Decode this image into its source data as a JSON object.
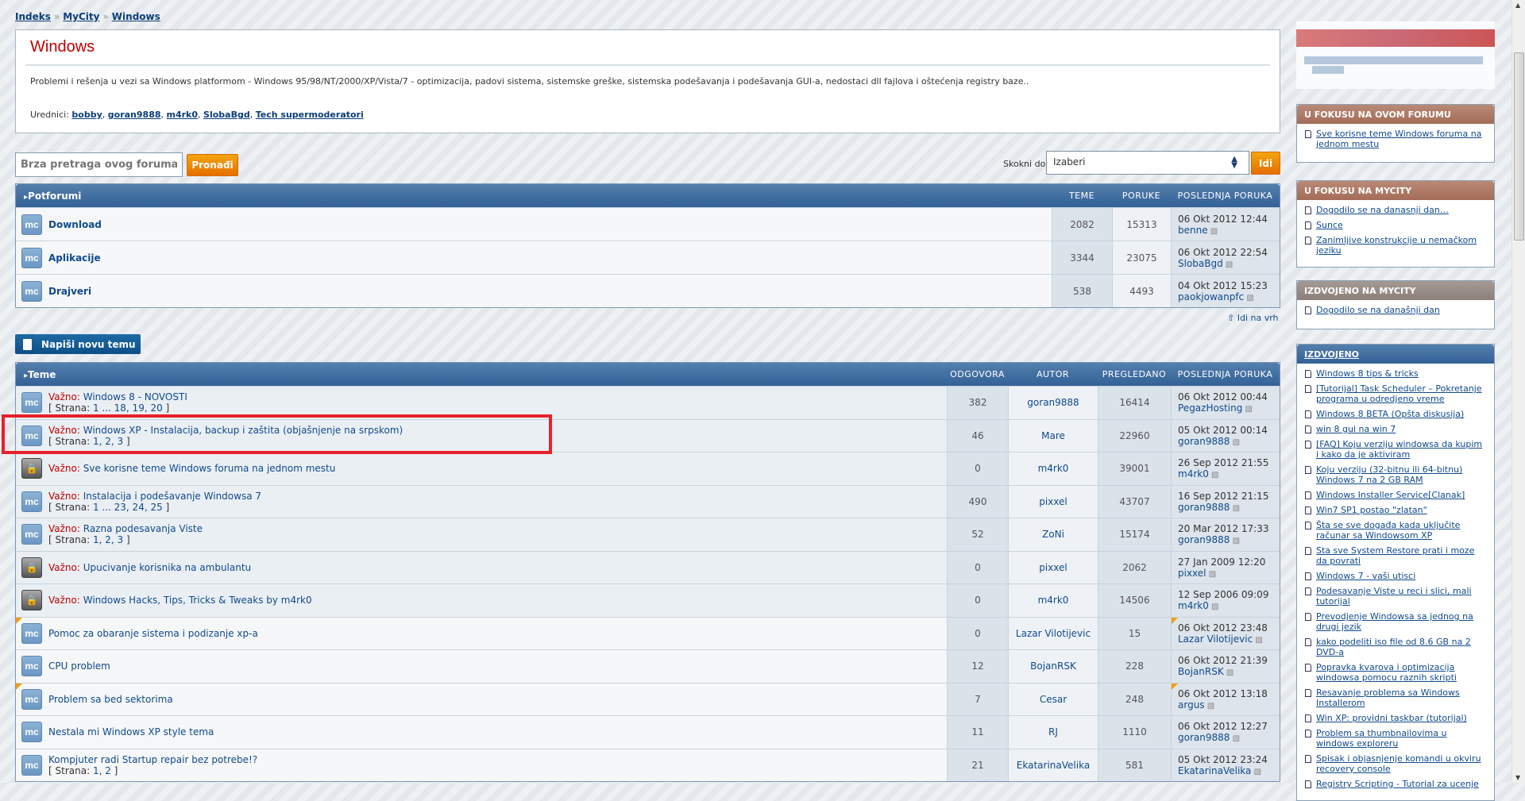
{
  "breadcrumb": [
    "Indeks",
    "MyCity",
    "Windows"
  ],
  "forum": {
    "title": "Windows",
    "description": "Problemi i rešenja u vezi sa Windows platformom - Windows 95/98/NT/2000/XP/Vista/7 - optimizacija, padovi sistema, sistemske greške, sistemska podešavanja i podešavanja GUI-a, nedostaci dll fajlova i oštećenja registry baze..",
    "moderators_label": "Urednici:",
    "moderators": [
      "bobby",
      "goran9888",
      "m4rk0",
      "SlobaBgd",
      "Tech supermoderatori"
    ]
  },
  "search": {
    "placeholder": "Brza pretraga ovog foruma...",
    "button": "Pronađi"
  },
  "jump": {
    "label": "Skokni do:",
    "selected": "Izaberi",
    "button": "Idi"
  },
  "subforums": {
    "title": "Potforumi",
    "columns": [
      "TEME",
      "PORUKE",
      "POSLEDNJA PORUKA"
    ],
    "rows": [
      {
        "name": "Download",
        "topics": "2082",
        "posts": "15313",
        "last_date": "06 Okt 2012 12:44",
        "last_user": "benne"
      },
      {
        "name": "Aplikacije",
        "topics": "3344",
        "posts": "23075",
        "last_date": "06 Okt 2012 22:54",
        "last_user": "SlobaBgd"
      },
      {
        "name": "Drajveri",
        "topics": "538",
        "posts": "4493",
        "last_date": "04 Okt 2012 15:23",
        "last_user": "paokjowanpfc"
      }
    ]
  },
  "back_to_top": "Idi na vrh",
  "new_topic": "Napiši novu temu",
  "topics": {
    "title": "Teme",
    "columns": [
      "ODGOVORA",
      "AUTOR",
      "PREGLEDANO",
      "POSLEDNJA PORUKA"
    ],
    "important_label": "Važno:",
    "pages_label": "Strana:",
    "rows": [
      {
        "icon": "mc",
        "important": true,
        "title": "Windows 8 - NOVOSTI",
        "pages": "1 ... 18, 19, 20",
        "replies": "382",
        "author": "goran9888",
        "views": "16414",
        "last_date": "06 Okt 2012 00:44",
        "last_user": "PegazHosting"
      },
      {
        "icon": "mc",
        "important": true,
        "title": "Windows XP - Instalacija, backup i zaštita (objašnjenje na srpskom)",
        "pages": "1, 2, 3",
        "replies": "46",
        "author": "Mare",
        "views": "22960",
        "last_date": "05 Okt 2012 00:14",
        "last_user": "goran9888"
      },
      {
        "icon": "lock",
        "important": true,
        "title": "Sve korisne teme Windows foruma na jednom mestu",
        "pages": "",
        "replies": "0",
        "author": "m4rk0",
        "views": "39001",
        "last_date": "26 Sep 2012 21:55",
        "last_user": "m4rk0"
      },
      {
        "icon": "mc",
        "important": true,
        "title": "Instalacija i podešavanje Windowsa 7",
        "pages": "1 ... 23, 24, 25",
        "replies": "490",
        "author": "pixxel",
        "views": "43707",
        "last_date": "16 Sep 2012 21:15",
        "last_user": "goran9888"
      },
      {
        "icon": "mc",
        "important": true,
        "title": "Razna podesavanja Viste",
        "pages": "1, 2, 3",
        "replies": "52",
        "author": "ZoNi",
        "views": "15174",
        "last_date": "20 Mar 2012 17:33",
        "last_user": "goran9888"
      },
      {
        "icon": "lock",
        "important": true,
        "title": "Upucivanje korisnika na ambulantu",
        "pages": "",
        "replies": "0",
        "author": "pixxel",
        "views": "2062",
        "last_date": "27 Jan 2009 12:20",
        "last_user": "pixxel"
      },
      {
        "icon": "lock",
        "important": true,
        "title": "Windows Hacks, Tips, Tricks & Tweaks by m4rk0",
        "pages": "",
        "replies": "0",
        "author": "m4rk0",
        "views": "14506",
        "last_date": "12 Sep 2006 09:09",
        "last_user": "m4rk0"
      },
      {
        "icon": "mc",
        "important": false,
        "new": true,
        "title": "Pomoc za obaranje sistema i podizanje xp-a",
        "pages": "",
        "replies": "0",
        "author": "Lazar Vilotijevic",
        "views": "15",
        "last_date": "06 Okt 2012 23:48",
        "last_user": "Lazar Vilotijevic"
      },
      {
        "icon": "mc",
        "important": false,
        "title": "CPU problem",
        "pages": "",
        "replies": "12",
        "author": "BojanRSK",
        "views": "228",
        "last_date": "06 Okt 2012 21:39",
        "last_user": "BojanRSK"
      },
      {
        "icon": "mc",
        "important": false,
        "new": true,
        "title": "Problem sa bed sektorima",
        "pages": "",
        "replies": "7",
        "author": "Cesar",
        "views": "248",
        "last_date": "06 Okt 2012 13:18",
        "last_user": "argus"
      },
      {
        "icon": "mc",
        "important": false,
        "title": "Nestala mi Windows XP style tema",
        "pages": "",
        "replies": "11",
        "author": "RJ",
        "views": "1110",
        "last_date": "06 Okt 2012 12:27",
        "last_user": "goran9888"
      },
      {
        "icon": "mc",
        "important": false,
        "title": "Kompjuter radi Startup repair bez potrebe!?",
        "pages": "1, 2",
        "replies": "21",
        "author": "EkatarinaVelika",
        "views": "581",
        "last_date": "05 Okt 2012 23:24",
        "last_user": "EkatarinaVelika"
      }
    ]
  },
  "sidebar": [
    {
      "title": "U FOKUSU NA OVOM FORUMU",
      "style": "brown",
      "items": [
        "Sve korisne teme Windows foruma na jednom mestu"
      ]
    },
    {
      "title": "U FOKUSU NA MYCITY",
      "style": "brown",
      "items": [
        "Dogodilo se na danasnji dan…",
        "Sunce",
        "Zanimljive konstrukcije u nemačkom jeziku"
      ]
    },
    {
      "title": "IZDVOJENO NA MYCITY",
      "style": "gray",
      "items": [
        "Dogodilo se na današnji dan"
      ]
    },
    {
      "title": "IZDVOJENO",
      "style": "blue",
      "items": [
        "Windows 8 tips & tricks",
        "[Tutorijal] Task Scheduler – Pokretanje programa u odredjeno vreme",
        "Windows 8 BETA (Opšta diskusija)",
        "win 8 gui na win 7",
        "[FAQ] Koju verziju windowsa da kupim i kako da je aktiviram",
        "Koju verziju (32-bitnu ili 64-bitnu) Windows 7 na 2 GB RAM",
        "Windows Installer Service[Clanak]",
        "Win7 SP1 postao \"zlatan\"",
        "Šta se sve događa kada uključite računar sa Windowsom XP",
        "Sta sve System Restore prati i moze da povrati",
        "Windows 7 - vaši utisci",
        "Podesavanje Viste u reci i slici, mali tutorijal",
        "Prevodjenje Windowsa sa jednog na drugi jezik",
        "kako podeliti iso file od 8.6 GB na 2 DVD-a",
        "Popravka kvarova i optimizacija windowsa pomocu raznih skripti",
        "Resavanje problema sa Windows Installerom",
        "Win XP: providni taskbar (tutorijal)",
        "Problem sa thumbnailovima u windows exploreru",
        "Spisak i objasnjenje komandi u okviru recovery console",
        "Registry Scripting - Tutorial za ucenje"
      ]
    }
  ]
}
